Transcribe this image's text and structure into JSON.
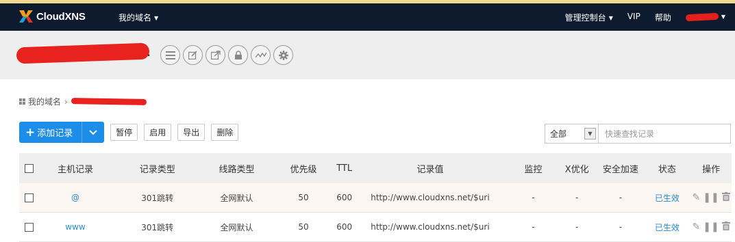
{
  "navbar": {
    "logo_text": "CloudXNS",
    "domains_menu": "我的域名",
    "console_menu": "管理控制台",
    "vip": "VIP",
    "help": "帮助"
  },
  "breadcrumb": {
    "root": "我的域名"
  },
  "actions": {
    "add_record": "添加记录",
    "pause": "暂停",
    "enable": "启用",
    "export": "导出",
    "delete": "删除"
  },
  "filter": {
    "select_value": "全部",
    "search_placeholder": "快速查找记录"
  },
  "table": {
    "headers": [
      "主机记录",
      "记录类型",
      "线路类型",
      "优先级",
      "TTL",
      "记录值",
      "监控",
      "X优化",
      "安全加速",
      "状态",
      "操作"
    ],
    "rows": [
      {
        "host": "@",
        "type": "301跳转",
        "line": "全网默认",
        "priority": "50",
        "ttl": "600",
        "value": "http://www.cloudxns.net/$uri",
        "monitor": "-",
        "xopt": "-",
        "secure": "-",
        "status": "已生效"
      },
      {
        "host": "www",
        "type": "301跳转",
        "line": "全网默认",
        "priority": "50",
        "ttl": "600",
        "value": "http://www.cloudxns.net/$uri",
        "monitor": "-",
        "xopt": "-",
        "secure": "-",
        "status": "已生效"
      }
    ]
  },
  "colors": {
    "navbar": "#0e1b2f",
    "accent": "#1c8de8",
    "link": "#2a8ad6"
  },
  "icons": [
    "list-icon",
    "edit-icon",
    "share-icon",
    "lock-icon",
    "monitor-icon",
    "gear-icon",
    "pencil-icon",
    "pause-icon",
    "trash-icon"
  ]
}
